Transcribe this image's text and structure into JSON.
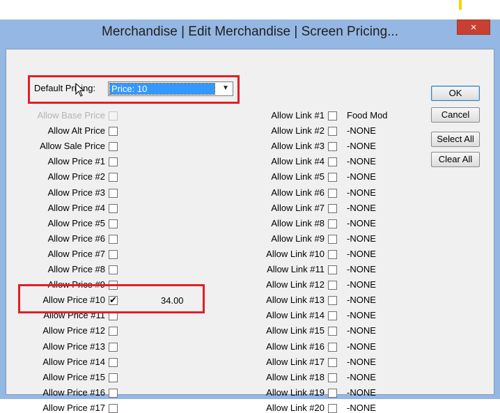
{
  "window": {
    "title": "Merchandise | Edit Merchandise | Screen Pricing...",
    "close": "×"
  },
  "default_pricing": {
    "label": "Default Pricing:",
    "value": "Price: 10"
  },
  "buttons": {
    "ok": "OK",
    "cancel": "Cancel",
    "select_all": "Select All",
    "clear_all": "Clear All"
  },
  "price_options": [
    {
      "label": "Allow Base Price",
      "checked": false,
      "disabled": true
    },
    {
      "label": "Allow Alt Price",
      "checked": false
    },
    {
      "label": "Allow Sale Price",
      "checked": false
    },
    {
      "label": "Allow Price #1",
      "checked": false
    },
    {
      "label": "Allow Price #2",
      "checked": false
    },
    {
      "label": "Allow Price #3",
      "checked": false
    },
    {
      "label": "Allow Price #4",
      "checked": false
    },
    {
      "label": "Allow Price #5",
      "checked": false
    },
    {
      "label": "Allow Price #6",
      "checked": false
    },
    {
      "label": "Allow Price #7",
      "checked": false
    },
    {
      "label": "Allow Price #8",
      "checked": false
    },
    {
      "label": "Allow Price #9",
      "checked": false
    },
    {
      "label": "Allow Price #10",
      "checked": true,
      "value": "34.00"
    },
    {
      "label": "Allow Price #11",
      "checked": false
    },
    {
      "label": "Allow Price #12",
      "checked": false
    },
    {
      "label": "Allow Price #13",
      "checked": false
    },
    {
      "label": "Allow Price #14",
      "checked": false
    },
    {
      "label": "Allow Price #15",
      "checked": false
    },
    {
      "label": "Allow Price #16",
      "checked": false
    },
    {
      "label": "Allow Price #17",
      "checked": false
    }
  ],
  "link_options": [
    {
      "label": "Allow Link #1",
      "value": "Food Mod",
      "checked": false
    },
    {
      "label": "Allow Link #2",
      "value": "-NONE",
      "checked": false
    },
    {
      "label": "Allow Link #3",
      "value": "-NONE",
      "checked": false
    },
    {
      "label": "Allow Link #4",
      "value": "-NONE",
      "checked": false
    },
    {
      "label": "Allow Link #5",
      "value": "-NONE",
      "checked": false
    },
    {
      "label": "Allow Link #6",
      "value": "-NONE",
      "checked": false
    },
    {
      "label": "Allow Link #7",
      "value": "-NONE",
      "checked": false
    },
    {
      "label": "Allow Link #8",
      "value": "-NONE",
      "checked": false
    },
    {
      "label": "Allow Link #9",
      "value": "-NONE",
      "checked": false
    },
    {
      "label": "Allow Link #10",
      "value": "-NONE",
      "checked": false
    },
    {
      "label": "Allow Link #11",
      "value": "-NONE",
      "checked": false
    },
    {
      "label": "Allow Link #12",
      "value": "-NONE",
      "checked": false
    },
    {
      "label": "Allow Link #13",
      "value": "-NONE",
      "checked": false
    },
    {
      "label": "Allow Link #14",
      "value": "-NONE",
      "checked": false
    },
    {
      "label": "Allow Link #15",
      "value": "-NONE",
      "checked": false
    },
    {
      "label": "Allow Link #16",
      "value": "-NONE",
      "checked": false
    },
    {
      "label": "Allow Link #17",
      "value": "-NONE",
      "checked": false
    },
    {
      "label": "Allow Link #18",
      "value": "-NONE",
      "checked": false
    },
    {
      "label": "Allow Link #19",
      "value": "-NONE",
      "checked": false
    },
    {
      "label": "Allow Link #20",
      "value": "-NONE",
      "checked": false
    }
  ],
  "colors": {
    "frame": "#95b7e3",
    "client": "#f0f0f0",
    "highlight": "#e01f26",
    "selection": "#3399ff",
    "close": "#c84031"
  }
}
